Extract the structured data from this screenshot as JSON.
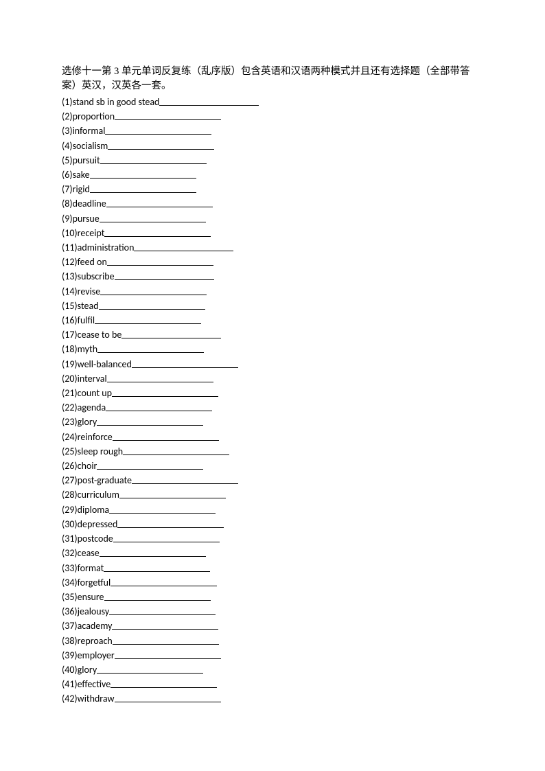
{
  "title": "选修十一第 3 单元单词反复练（乱序版）包含英语和汉语两种模式并且还有选择题（全部带答案）英汉，汉英各一套。",
  "items": [
    {
      "n": 1,
      "word": "stand sb in good stead",
      "line": 145
    },
    {
      "n": 2,
      "word": "proportion",
      "line": 155
    },
    {
      "n": 3,
      "word": "informal",
      "line": 155
    },
    {
      "n": 4,
      "word": "socialism",
      "line": 155
    },
    {
      "n": 5,
      "word": "pursuit",
      "line": 155
    },
    {
      "n": 6,
      "word": "sake",
      "line": 155
    },
    {
      "n": 7,
      "word": "rigid",
      "line": 155
    },
    {
      "n": 8,
      "word": "deadline",
      "line": 155
    },
    {
      "n": 9,
      "word": "pursue",
      "line": 155
    },
    {
      "n": 10,
      "word": "receipt",
      "line": 155
    },
    {
      "n": 11,
      "word": "administration",
      "line": 145
    },
    {
      "n": 12,
      "word": "feed on",
      "line": 155
    },
    {
      "n": 13,
      "word": "subscribe",
      "line": 145
    },
    {
      "n": 14,
      "word": "revise",
      "line": 155
    },
    {
      "n": 15,
      "word": "stead",
      "line": 155
    },
    {
      "n": 16,
      "word": "fulfil",
      "line": 155
    },
    {
      "n": 17,
      "word": "cease to be",
      "line": 145
    },
    {
      "n": 18,
      "word": "myth",
      "line": 155
    },
    {
      "n": 19,
      "word": "well-balanced",
      "line": 155
    },
    {
      "n": 20,
      "word": "interval",
      "line": 155
    },
    {
      "n": 21,
      "word": "count up",
      "line": 155
    },
    {
      "n": 22,
      "word": "agenda",
      "line": 155
    },
    {
      "n": 23,
      "word": "glory",
      "line": 155
    },
    {
      "n": 24,
      "word": "reinforce",
      "line": 155
    },
    {
      "n": 25,
      "word": "sleep rough",
      "line": 155
    },
    {
      "n": 26,
      "word": "choir",
      "line": 155
    },
    {
      "n": 27,
      "word": "post-graduate",
      "line": 155
    },
    {
      "n": 28,
      "word": "curriculum",
      "line": 155
    },
    {
      "n": 29,
      "word": "diploma",
      "line": 155
    },
    {
      "n": 30,
      "word": "depressed",
      "line": 155
    },
    {
      "n": 31,
      "word": "postcode",
      "line": 155
    },
    {
      "n": 32,
      "word": "cease",
      "line": 155
    },
    {
      "n": 33,
      "word": "format",
      "line": 155
    },
    {
      "n": 34,
      "word": "forgetful",
      "line": 155
    },
    {
      "n": 35,
      "word": "ensure",
      "line": 155
    },
    {
      "n": 36,
      "word": "jealousy",
      "line": 155
    },
    {
      "n": 37,
      "word": "academy",
      "line": 155
    },
    {
      "n": 38,
      "word": "reproach",
      "line": 155
    },
    {
      "n": 39,
      "word": "employer",
      "line": 155
    },
    {
      "n": 40,
      "word": "glory",
      "line": 155
    },
    {
      "n": 41,
      "word": "effective",
      "line": 155
    },
    {
      "n": 42,
      "word": "withdraw",
      "line": 155
    }
  ]
}
